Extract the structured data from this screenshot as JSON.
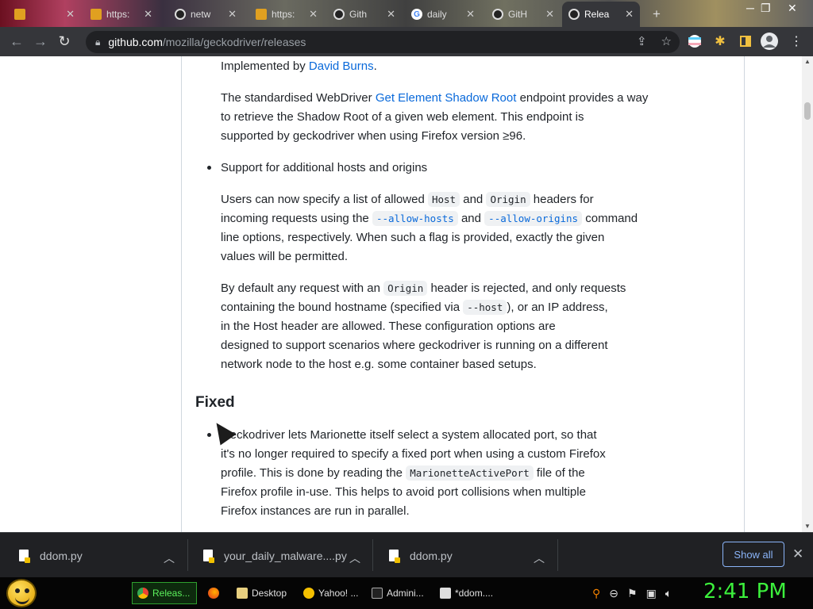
{
  "browser": {
    "tabs": [
      {
        "label": "",
        "active": false
      },
      {
        "label": "https:",
        "active": false
      },
      {
        "label": "netw",
        "active": false
      },
      {
        "label": "https:",
        "active": false
      },
      {
        "label": "Gith",
        "active": false
      },
      {
        "label": "daily",
        "active": false
      },
      {
        "label": "GitH",
        "active": false
      },
      {
        "label": "Relea",
        "active": true
      }
    ],
    "url_domain": "github.com",
    "url_path": "/mozilla/geckodriver/releases"
  },
  "article": {
    "p1_text": "Implemented by ",
    "p1_link": "David Burns",
    "p2_pre": "The standardised WebDriver ",
    "p2_link": "Get Element Shadow Root",
    "p2_line1_post": " endpoint provides a way",
    "p2_line2": "to retrieve the Shadow Root of a given web element. This endpoint is",
    "p2_line3": "supported by geckodriver when using Firefox version ≥96.",
    "bullet2": "Support for additional hosts and origins",
    "p3_a": "Users can now specify a list of allowed ",
    "p3_code1": "Host",
    "p3_b": " and ",
    "p3_code2": "Origin",
    "p3_c": " headers for",
    "p3_d": "incoming requests using the ",
    "p3_code3": "--allow-hosts",
    "p3_e": " and ",
    "p3_code4": "--allow-origins",
    "p3_f": " command",
    "p3_line3": "line options, respectively. When such a flag is provided, exactly the given",
    "p3_line4": "values will be permitted.",
    "p4_a": "By default any request with an ",
    "p4_code1": "Origin",
    "p4_b": " header is rejected, and only requests",
    "p4_c": "containing the bound hostname (specified via ",
    "p4_code2": "--host",
    "p4_d": "), or an IP address,",
    "p4_line3": "in the Host header are allowed. These configuration options are",
    "p4_line4": "designed to support scenarios where geckodriver is running on a different",
    "p4_line5": "network node to the host e.g. some container based setups.",
    "heading_fixed": "Fixed",
    "p5_line1": "Geckodriver lets Marionette itself select a system allocated port, so that",
    "p5_line2": "it's no longer required to specify a fixed port when using a custom Firefox",
    "p5_a": "profile. This is done by reading the ",
    "p5_code": "MarionetteActivePort",
    "p5_b": " file of the",
    "p5_line4": "Firefox profile in-use. This helps to avoid port collisions when multiple",
    "p5_line5": "Firefox instances are run in parallel."
  },
  "downloads": {
    "items": [
      "ddom.py",
      "your_daily_malware....py",
      "ddom.py"
    ],
    "show_all": "Show all"
  },
  "taskbar": {
    "buttons": [
      "Releas...",
      "",
      "Desktop",
      "Yahoo! ...",
      "Admini...",
      "*ddom...."
    ],
    "clock": "2:41 PM"
  }
}
